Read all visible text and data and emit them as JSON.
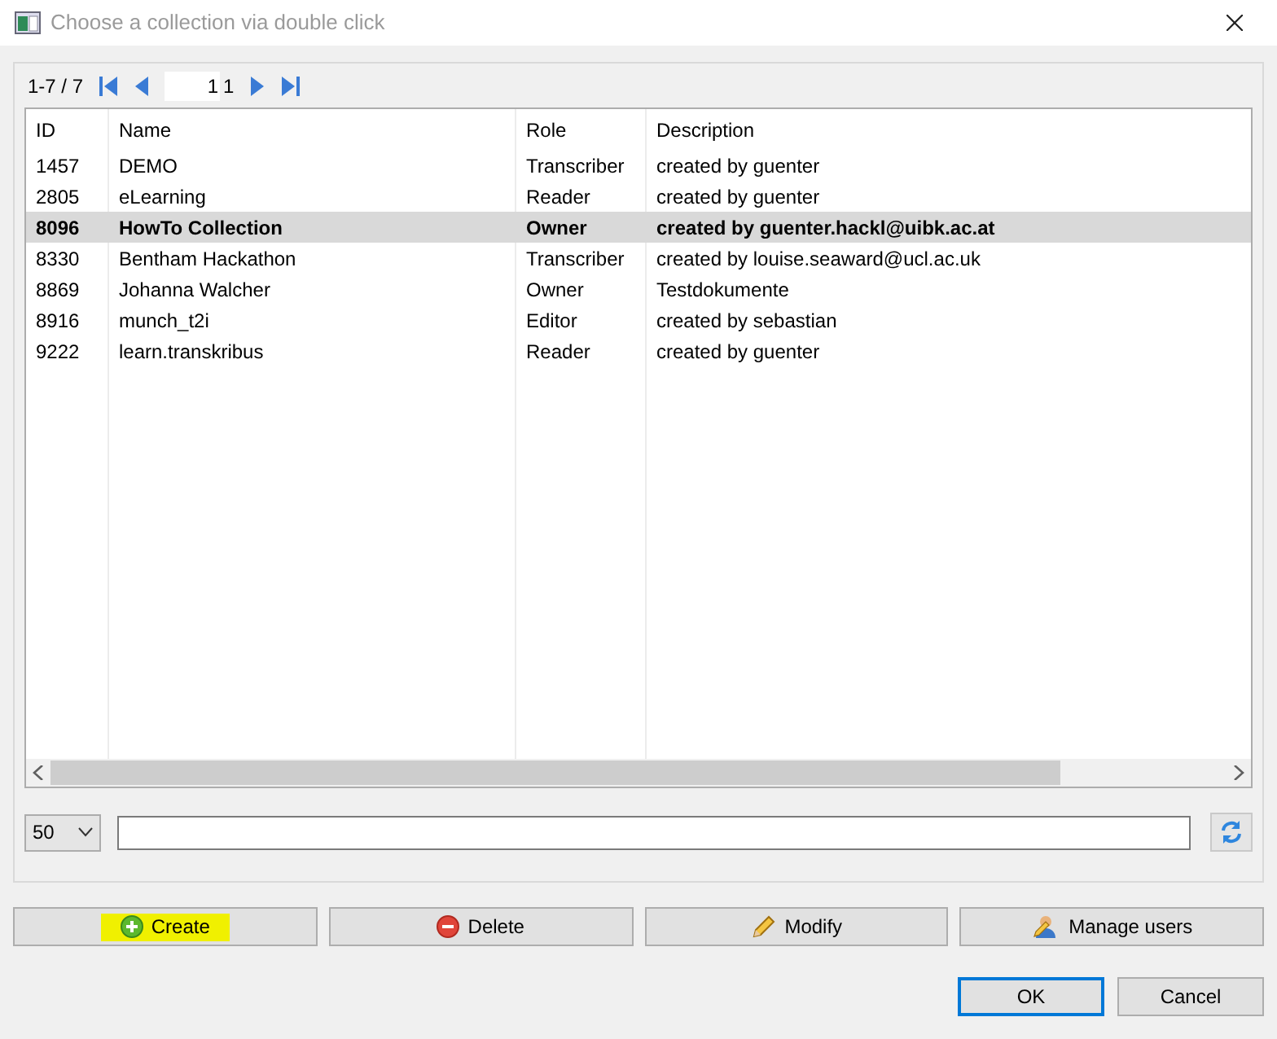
{
  "window": {
    "title": "Choose a collection via double click"
  },
  "pager": {
    "range": "1-7 / 7",
    "page": "1",
    "total": "1"
  },
  "table": {
    "columns": [
      "ID",
      "Name",
      "Role",
      "Description"
    ],
    "rows": [
      {
        "cells": [
          "1457",
          "DEMO",
          "Transcriber",
          "created by guenter"
        ],
        "selected": false
      },
      {
        "cells": [
          "2805",
          "eLearning",
          "Reader",
          "created by guenter"
        ],
        "selected": false
      },
      {
        "cells": [
          "8096",
          "HowTo Collection",
          "Owner",
          "created by guenter.hackl@uibk.ac.at"
        ],
        "selected": true
      },
      {
        "cells": [
          "8330",
          "Bentham Hackathon",
          "Transcriber",
          "created by louise.seaward@ucl.ac.uk"
        ],
        "selected": false
      },
      {
        "cells": [
          "8869",
          "Johanna Walcher",
          "Owner",
          "Testdokumente"
        ],
        "selected": false
      },
      {
        "cells": [
          "8916",
          "munch_t2i",
          "Editor",
          "created by sebastian"
        ],
        "selected": false
      },
      {
        "cells": [
          "9222",
          "learn.transkribus",
          "Reader",
          "created by guenter"
        ],
        "selected": false
      }
    ]
  },
  "page_size": "50",
  "actions": [
    {
      "label": "Create",
      "kind": "create",
      "highlighted": true
    },
    {
      "label": "Delete",
      "kind": "delete",
      "highlighted": false
    },
    {
      "label": "Modify",
      "kind": "modify",
      "highlighted": false
    },
    {
      "label": "Manage users",
      "kind": "users",
      "highlighted": false
    }
  ],
  "dialog_buttons": [
    {
      "label": "OK",
      "default": true
    },
    {
      "label": "Cancel",
      "default": false
    }
  ]
}
